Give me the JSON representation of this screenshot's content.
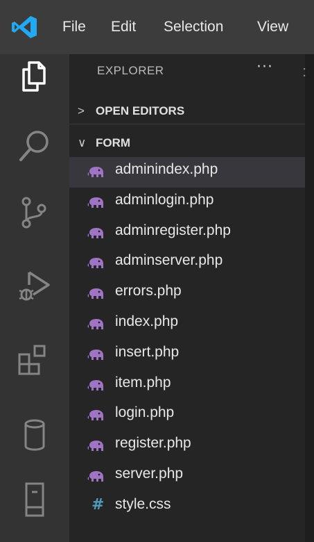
{
  "menu": {
    "file": "File",
    "edit": "Edit",
    "selection": "Selection",
    "view": "View"
  },
  "activity_bar": [
    {
      "name": "explorer",
      "icon": "files-icon",
      "active": true
    },
    {
      "name": "search",
      "icon": "search-icon",
      "active": false
    },
    {
      "name": "source-control",
      "icon": "source-control-icon",
      "active": false
    },
    {
      "name": "run-debug",
      "icon": "run-debug-icon",
      "active": false
    },
    {
      "name": "extensions",
      "icon": "extensions-icon",
      "active": false
    },
    {
      "name": "database",
      "icon": "database-icon",
      "active": false
    },
    {
      "name": "remote",
      "icon": "device-icon",
      "active": false
    }
  ],
  "editor": {
    "tab_fragment": ":"
  },
  "sidebar": {
    "title": "EXPLORER",
    "more": "···",
    "open_editors": {
      "label": "OPEN EDITORS",
      "expanded": false
    },
    "folder": {
      "label": "FORM",
      "expanded": true
    },
    "files": [
      {
        "name": "adminindex.php",
        "icon": "php-elephant-icon",
        "selected": true
      },
      {
        "name": "adminlogin.php",
        "icon": "php-elephant-icon"
      },
      {
        "name": "adminregister.php",
        "icon": "php-elephant-icon"
      },
      {
        "name": "adminserver.php",
        "icon": "php-elephant-icon"
      },
      {
        "name": "errors.php",
        "icon": "php-elephant-icon"
      },
      {
        "name": "index.php",
        "icon": "php-elephant-icon"
      },
      {
        "name": "insert.php",
        "icon": "php-elephant-icon"
      },
      {
        "name": "item.php",
        "icon": "php-elephant-icon"
      },
      {
        "name": "login.php",
        "icon": "php-elephant-icon"
      },
      {
        "name": "register.php",
        "icon": "php-elephant-icon"
      },
      {
        "name": "server.php",
        "icon": "php-elephant-icon"
      },
      {
        "name": "style.css",
        "icon": "css-hash-icon"
      }
    ]
  },
  "colors": {
    "titlebar": "#3c3c3c",
    "activitybar": "#333333",
    "sidebar": "#252526",
    "selected_row": "#37373d",
    "php_icon": "#a074c4",
    "css_icon": "#519aba",
    "vscode_blue": "#23a9f2"
  }
}
